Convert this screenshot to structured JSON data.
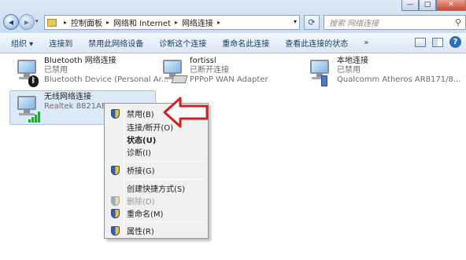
{
  "window": {
    "minimize": "—",
    "maximize": "□",
    "close": "✕"
  },
  "address": {
    "crumbs": [
      "控制面板",
      "网络和 Internet",
      "网络连接"
    ],
    "search_placeholder": "搜索 网络连接"
  },
  "toolbar": {
    "items": [
      "组织 ▾",
      "连接到",
      "禁用此网络设备",
      "诊断这个连接",
      "重命名此连接",
      "查看此连接的状态"
    ],
    "more": "»",
    "help": "?"
  },
  "connections": [
    {
      "name": "Bluetooth 网络连接",
      "status": "已禁用",
      "device": "Bluetooth Device (Personal Ar...",
      "badge": "bluetooth-icon"
    },
    {
      "name": "fortissl",
      "status": "已断开连接",
      "device": "PPPoP WAN Adapter",
      "badge": "modem-icon"
    },
    {
      "name": "本地连接",
      "status": "已禁用",
      "device": "Qualcomm Atheros AR8171/8...",
      "badge": "network-cable-icon"
    },
    {
      "name": "无线网络连接",
      "status": "",
      "device": "Realtek 8821AE W",
      "badge": "wifi-signal-icon"
    }
  ],
  "context_menu": {
    "items": [
      {
        "label": "禁用(B)",
        "shield": true,
        "bold": false,
        "disabled": false
      },
      {
        "label": "连接/断开(O)",
        "shield": false,
        "bold": false,
        "disabled": false
      },
      {
        "label": "状态(U)",
        "shield": false,
        "bold": true,
        "disabled": false
      },
      {
        "label": "诊断(I)",
        "shield": false,
        "bold": false,
        "disabled": false
      },
      {
        "label": "桥接(G)",
        "shield": true,
        "bold": false,
        "disabled": false
      },
      {
        "label": "创建快捷方式(S)",
        "shield": false,
        "bold": false,
        "disabled": false
      },
      {
        "label": "删除(D)",
        "shield": true,
        "bold": false,
        "disabled": true
      },
      {
        "label": "重命名(M)",
        "shield": true,
        "bold": false,
        "disabled": false
      },
      {
        "label": "属性(R)",
        "shield": true,
        "bold": false,
        "disabled": false
      }
    ]
  },
  "colors": {
    "annotation_arrow": "#d42020",
    "selection_bg": "#dce9f8",
    "toolbar_text": "#1e395b"
  }
}
